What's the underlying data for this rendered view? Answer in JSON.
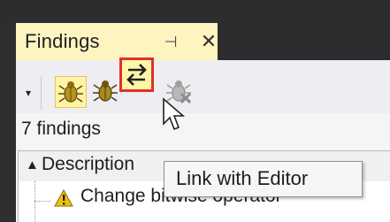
{
  "panel": {
    "title": "Findings",
    "pin_glyph": "⊣",
    "close_glyph": "✕"
  },
  "toolbar": {
    "dropdown_caret": "▾",
    "buttons": [
      {
        "name": "bug-filter-icon"
      },
      {
        "name": "bug-icon"
      },
      {
        "name": "link-with-editor-icon"
      },
      {
        "name": "disabled-bug-icon"
      }
    ]
  },
  "status": {
    "count_text": "7 findings"
  },
  "grid": {
    "sort_glyph": "▲",
    "column_header": "Description",
    "rows": [
      {
        "text": "Change bitwise operator"
      }
    ]
  },
  "tooltip": {
    "text": "Link with Editor"
  },
  "colors": {
    "title_background": "#fdf4bf",
    "highlight_border": "#e0302a",
    "warning": "#f2c10f"
  }
}
